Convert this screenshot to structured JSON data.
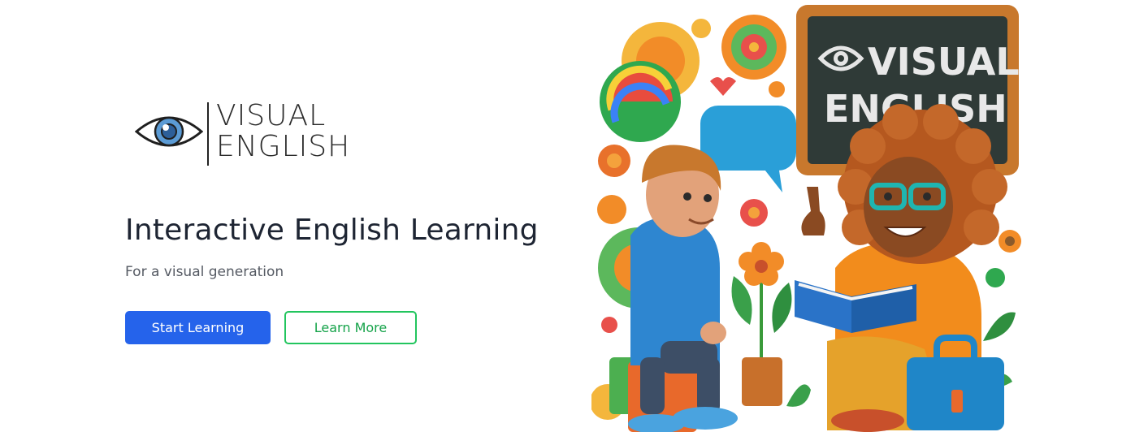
{
  "brand": {
    "logo_line1": "VISUAL",
    "logo_line2": "ENGLISH",
    "logo_icon": "eye-icon",
    "eye_color": "#5b9bd5"
  },
  "hero": {
    "title": "Interactive English Learning",
    "subtitle": "For a visual generation",
    "primary_button": "Start Learning",
    "secondary_button": "Learn More"
  },
  "illustration": {
    "board_line1": "VISUAL",
    "board_line2": "ENGLISH",
    "board_icon": "eye-icon"
  },
  "colors": {
    "primary": "#2563eb",
    "secondary": "#22c55e",
    "title": "#1e2533",
    "subtitle": "#555a63",
    "chalkboard": "#2f3a37",
    "board_frame": "#c8782d"
  }
}
